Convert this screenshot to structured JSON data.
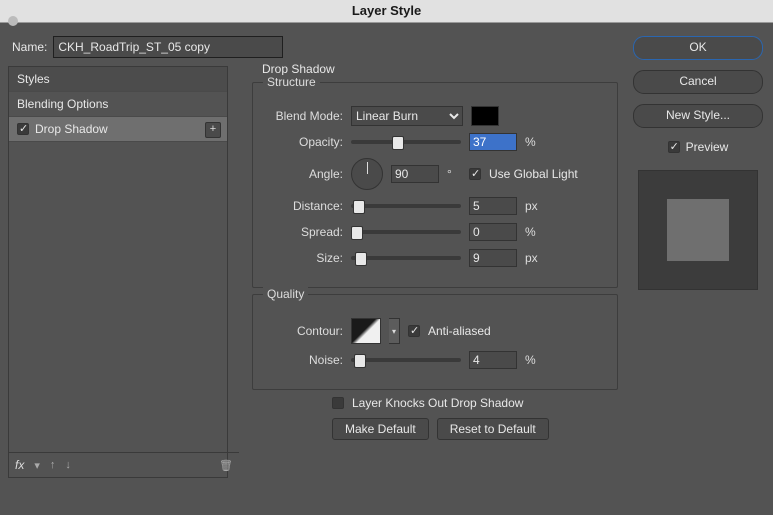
{
  "title": "Layer Style",
  "name_label": "Name:",
  "name_value": "CKH_RoadTrip_ST_05 copy",
  "styles_panel": {
    "header": "Styles",
    "blending": "Blending Options",
    "drop_shadow": {
      "checked": true,
      "label": "Drop Shadow"
    }
  },
  "effect": {
    "title": "Drop Shadow",
    "structure": "Structure",
    "blend_mode_label": "Blend Mode:",
    "blend_mode_value": "Linear Burn",
    "opacity_label": "Opacity:",
    "opacity_value": "37",
    "pct": "%",
    "angle_label": "Angle:",
    "angle_value": "90",
    "deg": "°",
    "use_global": "Use Global Light",
    "use_global_checked": true,
    "distance_label": "Distance:",
    "distance_value": "5",
    "px": "px",
    "spread_label": "Spread:",
    "spread_value": "0",
    "size_label": "Size:",
    "size_value": "9",
    "quality": "Quality",
    "contour_label": "Contour:",
    "anti_aliased": "Anti-aliased",
    "anti_aliased_checked": true,
    "noise_label": "Noise:",
    "noise_value": "4",
    "knockout": "Layer Knocks Out Drop Shadow",
    "knockout_checked": false,
    "make_default": "Make Default",
    "reset_default": "Reset to Default"
  },
  "right": {
    "ok": "OK",
    "cancel": "Cancel",
    "new_style": "New Style...",
    "preview_label": "Preview",
    "preview_checked": true
  },
  "footer": {
    "fx": "fx"
  }
}
